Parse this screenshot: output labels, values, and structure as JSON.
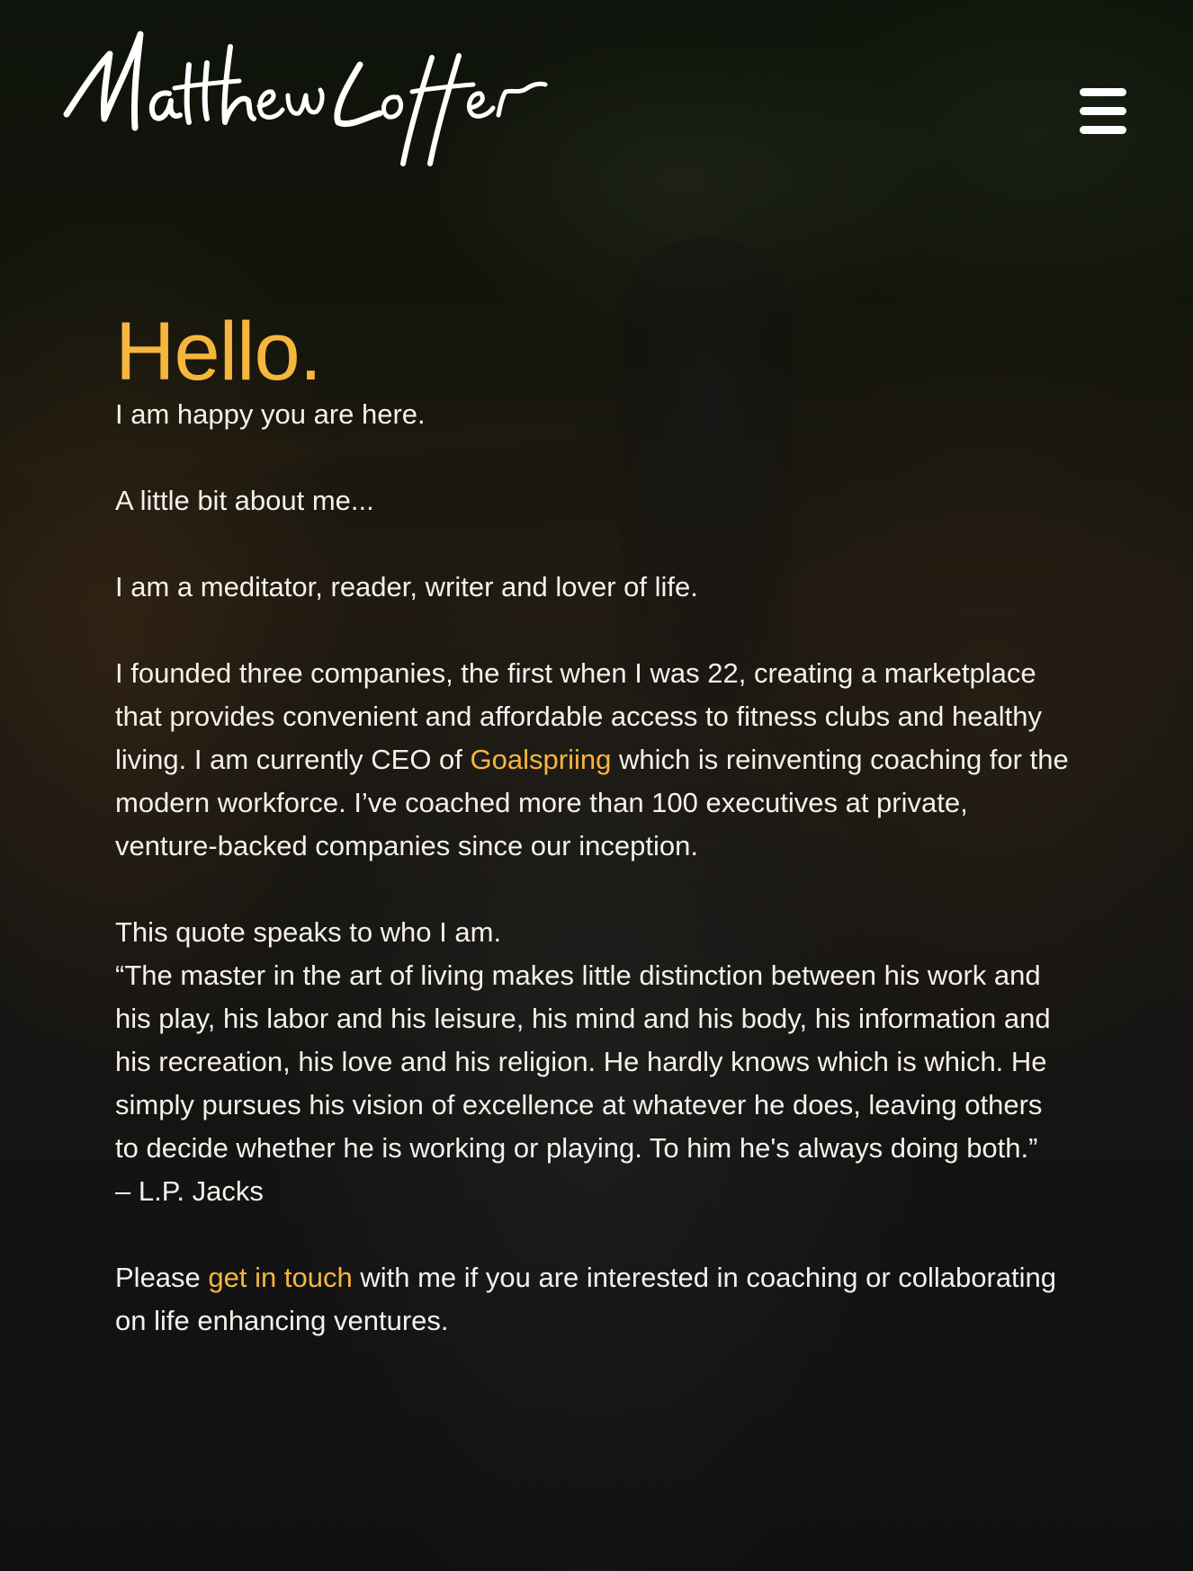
{
  "header": {
    "logo_text": "Matthew Loffer",
    "menu_icon": "hamburger-menu-icon"
  },
  "main": {
    "heading": "Hello.",
    "p1": "I am happy you are here.",
    "p2": "A little bit about me...",
    "p3": "I am a meditator, reader, writer and lover of life.",
    "p4_before": "I founded three companies, the first when I was 22, creating a marketplace that provides convenient and affordable access to fitness clubs and healthy living. I am currently CEO of",
    "p4_link": "Goalspriing",
    "p4_after": "which is reinventing coaching for the modern workforce. I’ve coached more than 100 executives at private, venture-backed companies since our inception.",
    "quote_intro": "This quote speaks to who I am.",
    "quote": "“The master in the art of living makes little distinction between his work and his play, his labor and his leisure, his mind and his body, his information and his recreation, his love and his religion. He hardly knows which is which. He simply pursues his vision of excellence at whatever he does, leaving others to decide whether he is working or playing. To him he's always doing both.”",
    "quote_author": "– L.P. Jacks",
    "contact_before": "Please",
    "contact_link": "get in touch",
    "contact_after": "with me if you are interested in coaching or collaborating on life enhancing ventures."
  },
  "colors": {
    "accent": "#f6b63c",
    "text": "#f4f1ea"
  }
}
